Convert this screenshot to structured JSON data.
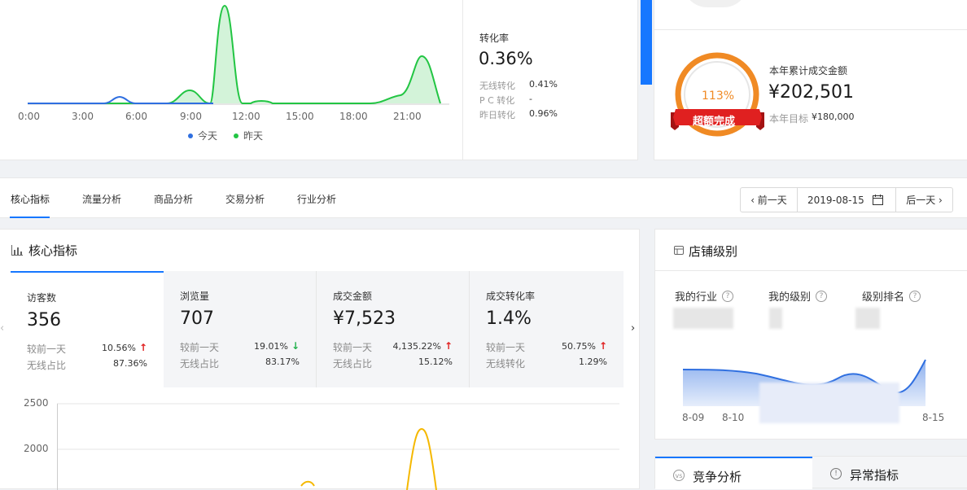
{
  "top_chart": {
    "x_ticks": [
      "0:00",
      "3:00",
      "6:00",
      "9:00",
      "12:00",
      "15:00",
      "18:00",
      "21:00"
    ],
    "legend": [
      {
        "name": "今天",
        "color": "#2f6fe0"
      },
      {
        "name": "昨天",
        "color": "#22c543"
      }
    ]
  },
  "conversion": {
    "title": "转化率",
    "value": "0.36%",
    "rows": [
      {
        "label": "无线转化",
        "value": "0.41%"
      },
      {
        "label": "P C 转化",
        "value": "-"
      },
      {
        "label": "昨日转化",
        "value": "0.96%"
      }
    ]
  },
  "annual": {
    "percent": "113%",
    "ribbon": "超额完成",
    "title": "本年累计成交金额",
    "value": "¥202,501",
    "target_label": "本年目标",
    "target_value": "¥180,000",
    "progress_percent": 113
  },
  "tabs": [
    {
      "label": "核心指标",
      "active": true
    },
    {
      "label": "流量分析",
      "active": false
    },
    {
      "label": "商品分析",
      "active": false
    },
    {
      "label": "交易分析",
      "active": false
    },
    {
      "label": "行业分析",
      "active": false
    }
  ],
  "date_nav": {
    "prev": "‹ 前一天",
    "date": "2019-08-15",
    "next": "后一天 ›"
  },
  "core": {
    "title": "核心指标",
    "kpis": [
      {
        "title": "访客数",
        "value": "356",
        "r1_label": "较前一天",
        "r1_value": "10.56%",
        "r1_dir": "up",
        "r2_label": "无线占比",
        "r2_value": "87.36%"
      },
      {
        "title": "浏览量",
        "value": "707",
        "r1_label": "较前一天",
        "r1_value": "19.01%",
        "r1_dir": "down",
        "r2_label": "无线占比",
        "r2_value": "83.17%"
      },
      {
        "title": "成交金额",
        "value": "¥7,523",
        "r1_label": "较前一天",
        "r1_value": "4,135.22%",
        "r1_dir": "up",
        "r2_label": "无线占比",
        "r2_value": "15.12%"
      },
      {
        "title": "成交转化率",
        "value": "1.4%",
        "r1_label": "较前一天",
        "r1_value": "50.75%",
        "r1_dir": "up",
        "r2_label": "无线转化",
        "r2_value": "1.29%"
      }
    ],
    "y_ticks": [
      "2500",
      "2000"
    ]
  },
  "shop": {
    "title": "店铺级别",
    "labels": [
      "我的行业",
      "我的级别",
      "级别排名"
    ],
    "x_ticks": [
      "8-09",
      "8-10",
      "8-15"
    ]
  },
  "bottom_tabs": [
    {
      "label": "竞争分析",
      "active": true
    },
    {
      "label": "异常指标",
      "active": false
    }
  ]
}
